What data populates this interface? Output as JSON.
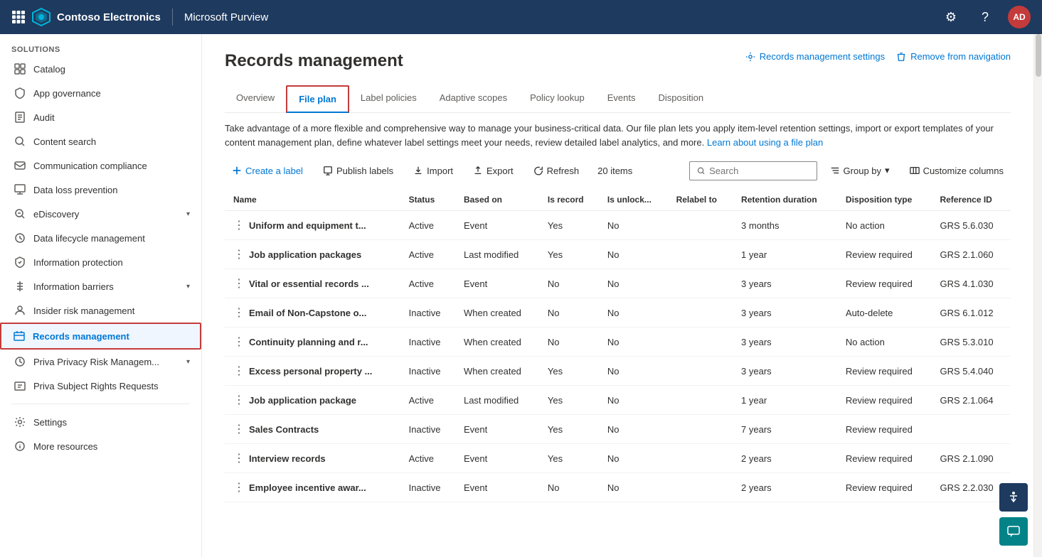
{
  "topNav": {
    "companyName": "Contoso Electronics",
    "productName": "Microsoft Purview",
    "avatarInitials": "AD"
  },
  "sidebar": {
    "sectionLabel": "Solutions",
    "items": [
      {
        "id": "catalog",
        "label": "Catalog",
        "icon": "grid"
      },
      {
        "id": "app-governance",
        "label": "App governance",
        "icon": "shield"
      },
      {
        "id": "audit",
        "label": "Audit",
        "icon": "audit"
      },
      {
        "id": "content-search",
        "label": "Content search",
        "icon": "search"
      },
      {
        "id": "communication-compliance",
        "label": "Communication compliance",
        "icon": "chat"
      },
      {
        "id": "data-loss-prevention",
        "label": "Data loss prevention",
        "icon": "dlp"
      },
      {
        "id": "ediscovery",
        "label": "eDiscovery",
        "icon": "discovery",
        "hasChevron": true
      },
      {
        "id": "data-lifecycle",
        "label": "Data lifecycle management",
        "icon": "lifecycle"
      },
      {
        "id": "information-protection",
        "label": "Information protection",
        "icon": "protection"
      },
      {
        "id": "information-barriers",
        "label": "Information barriers",
        "icon": "barriers",
        "hasChevron": true
      },
      {
        "id": "insider-risk",
        "label": "Insider risk management",
        "icon": "insider"
      },
      {
        "id": "records-management",
        "label": "Records management",
        "icon": "records",
        "active": true
      },
      {
        "id": "priva-privacy",
        "label": "Priva Privacy Risk Managem...",
        "icon": "privacy",
        "hasChevron": true
      },
      {
        "id": "priva-subject",
        "label": "Priva Subject Rights Requests",
        "icon": "rights"
      }
    ],
    "bottomItems": [
      {
        "id": "settings",
        "label": "Settings",
        "icon": "settings"
      },
      {
        "id": "more-resources",
        "label": "More resources",
        "icon": "more"
      }
    ]
  },
  "page": {
    "title": "Records management",
    "settingsLabel": "Records management settings",
    "removeNavLabel": "Remove from navigation",
    "description": "Take advantage of a more flexible and comprehensive way to manage your business-critical data. Our file plan lets you apply item-level retention settings, import or export templates of your content management plan, define whatever label settings meet your needs, review detailed label analytics, and more.",
    "learnMoreText": "Learn about using a file plan",
    "tabs": [
      {
        "id": "overview",
        "label": "Overview"
      },
      {
        "id": "file-plan",
        "label": "File plan",
        "active": true
      },
      {
        "id": "label-policies",
        "label": "Label policies"
      },
      {
        "id": "adaptive-scopes",
        "label": "Adaptive scopes"
      },
      {
        "id": "policy-lookup",
        "label": "Policy lookup"
      },
      {
        "id": "events",
        "label": "Events"
      },
      {
        "id": "disposition",
        "label": "Disposition"
      }
    ],
    "toolbar": {
      "createLabel": "Create a label",
      "publishLabel": "Publish labels",
      "importLabel": "Import",
      "exportLabel": "Export",
      "refreshLabel": "Refresh",
      "itemCount": "20 items",
      "searchPlaceholder": "Search",
      "groupByLabel": "Group by",
      "customizeLabel": "Customize columns"
    },
    "tableHeaders": [
      "Name",
      "Status",
      "Based on",
      "Is record",
      "Is unlock...",
      "Relabel to",
      "Retention duration",
      "Disposition type",
      "Reference ID"
    ],
    "tableRows": [
      {
        "name": "Uniform and equipment t...",
        "status": "Active",
        "basedOn": "Event",
        "isRecord": "Yes",
        "isUnlock": "No",
        "relabelTo": "",
        "retentionDuration": "3 months",
        "dispositionType": "No action",
        "referenceId": "GRS 5.6.030"
      },
      {
        "name": "Job application packages",
        "status": "Active",
        "basedOn": "Last modified",
        "isRecord": "Yes",
        "isUnlock": "No",
        "relabelTo": "",
        "retentionDuration": "1 year",
        "dispositionType": "Review required",
        "referenceId": "GRS 2.1.060"
      },
      {
        "name": "Vital or essential records ...",
        "status": "Active",
        "basedOn": "Event",
        "isRecord": "No",
        "isUnlock": "No",
        "relabelTo": "",
        "retentionDuration": "3 years",
        "dispositionType": "Review required",
        "referenceId": "GRS 4.1.030"
      },
      {
        "name": "Email of Non-Capstone o...",
        "status": "Inactive",
        "basedOn": "When created",
        "isRecord": "No",
        "isUnlock": "No",
        "relabelTo": "",
        "retentionDuration": "3 years",
        "dispositionType": "Auto-delete",
        "referenceId": "GRS 6.1.012"
      },
      {
        "name": "Continuity planning and r...",
        "status": "Inactive",
        "basedOn": "When created",
        "isRecord": "No",
        "isUnlock": "No",
        "relabelTo": "",
        "retentionDuration": "3 years",
        "dispositionType": "No action",
        "referenceId": "GRS 5.3.010"
      },
      {
        "name": "Excess personal property ...",
        "status": "Inactive",
        "basedOn": "When created",
        "isRecord": "Yes",
        "isUnlock": "No",
        "relabelTo": "",
        "retentionDuration": "3 years",
        "dispositionType": "Review required",
        "referenceId": "GRS 5.4.040"
      },
      {
        "name": "Job application package",
        "status": "Active",
        "basedOn": "Last modified",
        "isRecord": "Yes",
        "isUnlock": "No",
        "relabelTo": "",
        "retentionDuration": "1 year",
        "dispositionType": "Review required",
        "referenceId": "GRS 2.1.064"
      },
      {
        "name": "Sales Contracts",
        "status": "Inactive",
        "basedOn": "Event",
        "isRecord": "Yes",
        "isUnlock": "No",
        "relabelTo": "",
        "retentionDuration": "7 years",
        "dispositionType": "Review required",
        "referenceId": ""
      },
      {
        "name": "Interview records",
        "status": "Active",
        "basedOn": "Event",
        "isRecord": "Yes",
        "isUnlock": "No",
        "relabelTo": "",
        "retentionDuration": "2 years",
        "dispositionType": "Review required",
        "referenceId": "GRS 2.1.090"
      },
      {
        "name": "Employee incentive awar...",
        "status": "Inactive",
        "basedOn": "Event",
        "isRecord": "No",
        "isUnlock": "No",
        "relabelTo": "",
        "retentionDuration": "2 years",
        "dispositionType": "Review required",
        "referenceId": "GRS 2.2.030"
      }
    ]
  }
}
